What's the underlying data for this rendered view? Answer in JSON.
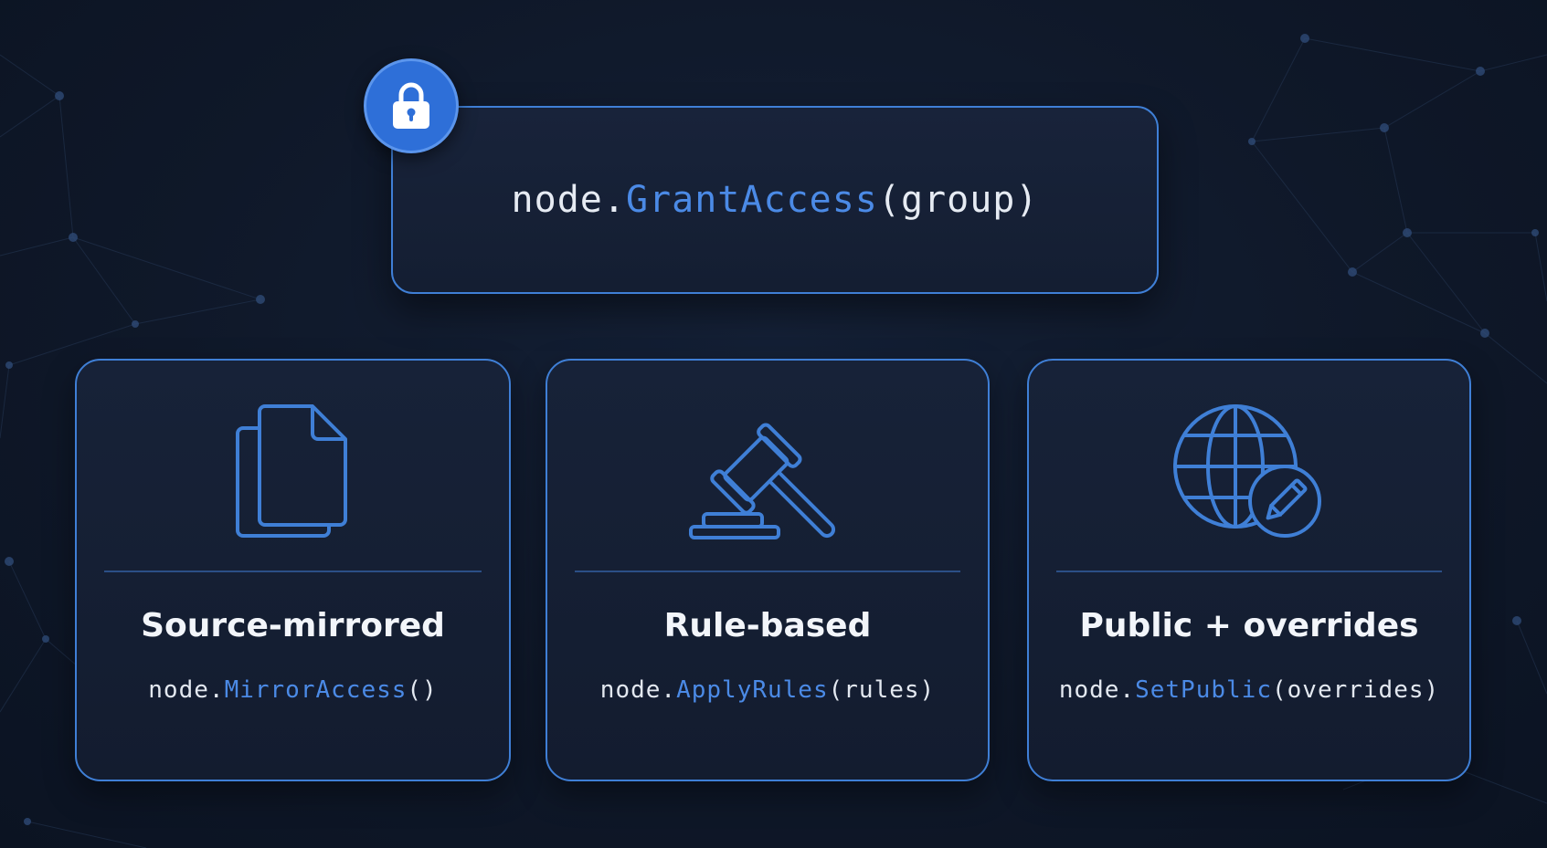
{
  "header": {
    "code_object": "node.",
    "code_method": "GrantAccess",
    "code_args": "(group)",
    "badge_icon": "lock-icon"
  },
  "cards": [
    {
      "icon": "documents-icon",
      "title": "Source-mirrored",
      "code_object": "node.",
      "code_method": "MirrorAccess",
      "code_args": "()"
    },
    {
      "icon": "gavel-icon",
      "title": "Rule-based",
      "code_object": "node.",
      "code_method": "ApplyRules",
      "code_args": "(rules)"
    },
    {
      "icon": "globe-edit-icon",
      "title": "Public + overrides",
      "code_object": "node.",
      "code_method": "SetPublic",
      "code_args": "(overrides)"
    }
  ],
  "colors": {
    "accent": "#3f7fd6",
    "method": "#4b8ae6",
    "badge": "#2e6fd8",
    "background": "#0f1829"
  }
}
